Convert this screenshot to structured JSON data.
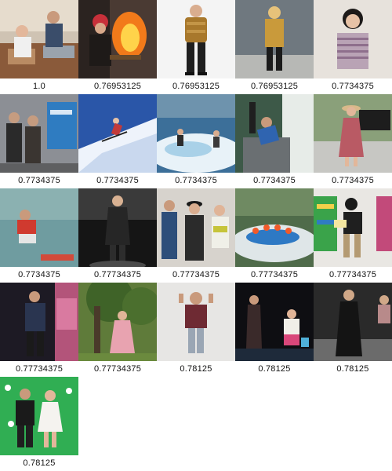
{
  "gallery": {
    "items": [
      {
        "score": "1.0",
        "scene": "people at laptops in a cafe"
      },
      {
        "score": "0.76953125",
        "scene": "man in red cap by open fire"
      },
      {
        "score": "0.76953125",
        "scene": "man in gold puffer jacket"
      },
      {
        "score": "0.76953125",
        "scene": "blonde woman in mustard coat on street"
      },
      {
        "score": "0.7734375",
        "scene": "woman in striped cardigan seated"
      },
      {
        "score": "0.7734375",
        "scene": "crowd near a blue sign"
      },
      {
        "score": "0.7734375",
        "scene": "skier on snowy slope"
      },
      {
        "score": "0.7734375",
        "scene": "surfer on wave pool"
      },
      {
        "score": "0.7734375",
        "scene": "man in blue shirt bending at desk"
      },
      {
        "score": "0.7734375",
        "scene": "woman in floral dress with hat"
      },
      {
        "score": "0.7734375",
        "scene": "man in red shirt crouching"
      },
      {
        "score": "0.77734375",
        "scene": "model on dark runway"
      },
      {
        "score": "0.77734375",
        "scene": "three people in hats posing"
      },
      {
        "score": "0.77734375",
        "scene": "rafting on rapids"
      },
      {
        "score": "0.77734375",
        "scene": "woman reading in bookstore"
      },
      {
        "score": "0.77734375",
        "scene": "man in jacket against graffiti"
      },
      {
        "score": "0.77734375",
        "scene": "person in pink robe by tree"
      },
      {
        "score": "0.78125",
        "scene": "man in maroon hoodie making peace sign"
      },
      {
        "score": "0.78125",
        "scene": "performers on dark stage"
      },
      {
        "score": "0.78125",
        "scene": "model in black coat on runway"
      },
      {
        "score": "0.78125",
        "scene": "couple on green backdrop"
      }
    ]
  }
}
